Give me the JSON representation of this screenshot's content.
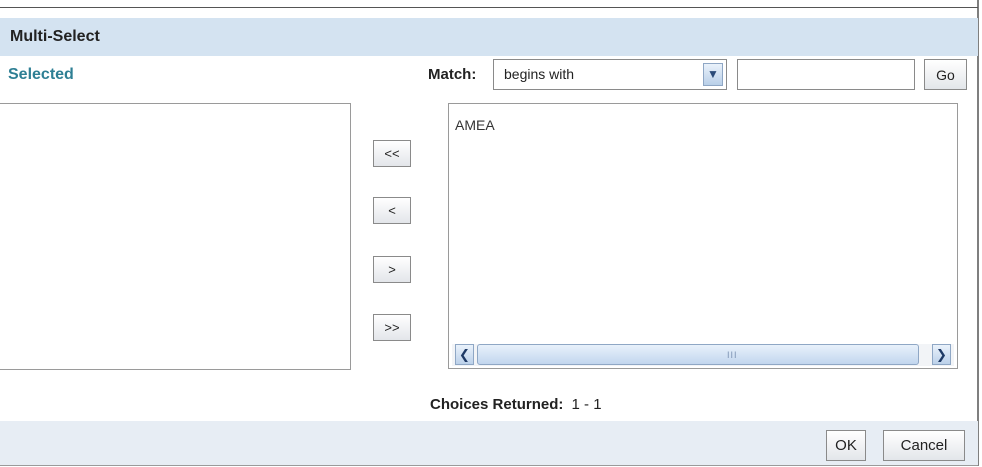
{
  "dialog": {
    "title": "Multi-Select"
  },
  "selected_panel": {
    "label": "Selected",
    "items": []
  },
  "search": {
    "match_label": "Match:",
    "match_mode": "begins with",
    "query": "",
    "go_label": "Go"
  },
  "move_buttons": {
    "remove_all": "<<",
    "remove": "<",
    "add": ">",
    "add_all": ">>"
  },
  "choices_panel": {
    "items": [
      "AMEA"
    ],
    "scrollbar_grip": "III",
    "returned_label": "Choices Returned:",
    "returned_value": "1 - 1"
  },
  "footer": {
    "ok_label": "OK",
    "cancel_label": "Cancel"
  },
  "colors": {
    "title_bar": "#d4e3f1",
    "selected_label": "#2e7f94",
    "footer": "#e7edf4"
  }
}
